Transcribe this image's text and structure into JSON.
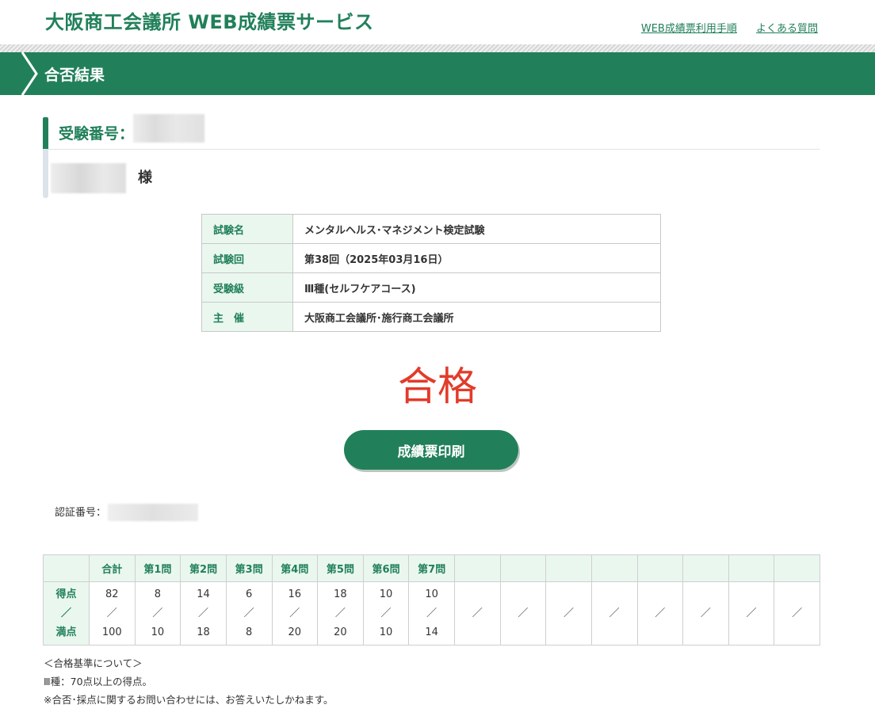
{
  "header": {
    "site_title": "大阪商工会議所 WEB成績票サービス",
    "links": [
      "WEB成績票利用手順",
      "よくある質問"
    ]
  },
  "title_bar": {
    "title": "合否結果"
  },
  "examinee": {
    "number_label": "受験番号：",
    "honorific": "様"
  },
  "exam_info": [
    {
      "key": "試験名",
      "value": "メンタルヘルス･マネジメント検定試験"
    },
    {
      "key": "試験回",
      "value": "第38回（2025年03月16日）"
    },
    {
      "key": "受験級",
      "value": "Ⅲ種(セルフケアコース)"
    },
    {
      "key": "主　催",
      "value": "大阪商工会議所･施行商工会議所"
    }
  ],
  "result": {
    "text": "合格",
    "color": "#e23b2a"
  },
  "print_button": {
    "label": "成績票印刷"
  },
  "cert": {
    "label": "認証番号："
  },
  "scores": {
    "row_label": [
      "得点",
      "／",
      "満点"
    ],
    "headers": [
      "合計",
      "第1問",
      "第2問",
      "第3問",
      "第4問",
      "第5問",
      "第6問",
      "第7問",
      "",
      "",
      "",
      "",
      "",
      "",
      "",
      ""
    ],
    "points": [
      "82",
      "8",
      "14",
      "6",
      "16",
      "18",
      "10",
      "10"
    ],
    "maxima": [
      "100",
      "10",
      "18",
      "8",
      "20",
      "20",
      "10",
      "14"
    ],
    "separator": "／",
    "empty_columns": 8
  },
  "notes": [
    "＜合格基準について＞",
    "Ⅲ種：70点以上の得点。",
    "※合否･採点に関するお問い合わせには、お答えいたしかねます。"
  ],
  "colors": {
    "brand_green": "#21805a",
    "light_green": "#eaf7ef"
  }
}
